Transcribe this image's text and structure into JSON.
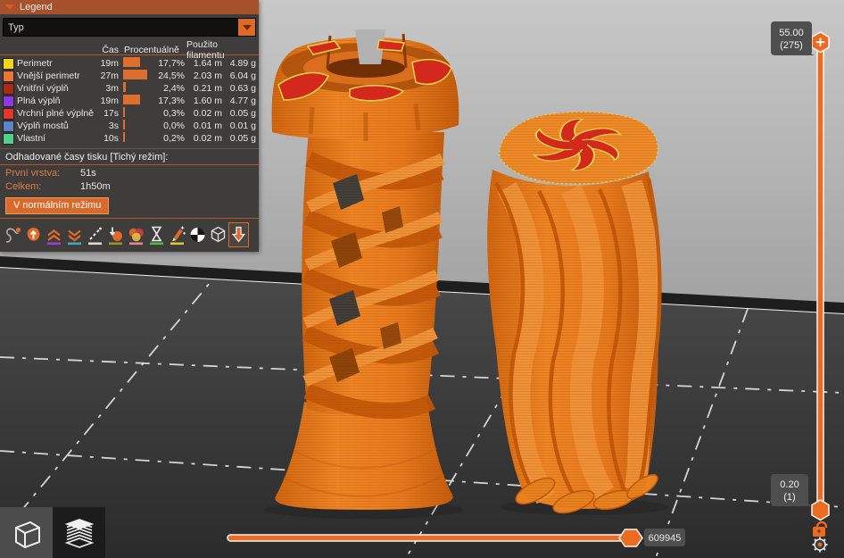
{
  "colors": {
    "accent": "#ed6b21",
    "legend_header_bg": "#a6512c",
    "panel_bg": "#3e3d3b",
    "tooltip_bg": "#4e4e4e",
    "bed_surface": "#3f3f3f",
    "model_orange": "#e87a22",
    "model_red": "#d3281c",
    "model_yellow": "#e8d44d"
  },
  "legend": {
    "title": "Legend",
    "view_type_dropdown": {
      "value": "Typ"
    },
    "table": {
      "headers": {
        "time": "Čas",
        "percent": "Procentuálně",
        "used": "Použito filamentu"
      },
      "rows": [
        {
          "color": "#f5d617",
          "label": "Perimetr",
          "time": "19m",
          "percent_value": 17.7,
          "percent": "17,7%",
          "length": "1.64 m",
          "weight": "4.89 g"
        },
        {
          "color": "#ed7435",
          "label": "Vnější perimetr",
          "time": "27m",
          "percent_value": 24.5,
          "percent": "24,5%",
          "length": "2.03 m",
          "weight": "6.04 g"
        },
        {
          "color": "#ab2a17",
          "label": "Vnitřní výplň",
          "time": "3m",
          "percent_value": 2.4,
          "percent": "2,4%",
          "length": "0.21 m",
          "weight": "0.63 g"
        },
        {
          "color": "#8f37e5",
          "label": "Plná výplň",
          "time": "19m",
          "percent_value": 17.3,
          "percent": "17,3%",
          "length": "1.60 m",
          "weight": "4.77 g"
        },
        {
          "color": "#e8352c",
          "label": "Vrchní plné výplně",
          "time": "17s",
          "percent_value": 0.3,
          "percent": "0,3%",
          "length": "0.02 m",
          "weight": "0.05 g"
        },
        {
          "color": "#5c85c7",
          "label": "Výplň mostů",
          "time": "3s",
          "percent_value": 0.0,
          "percent": "0,0%",
          "length": "0.01 m",
          "weight": "0.01 g"
        },
        {
          "color": "#50d08e",
          "label": "Vlastní",
          "time": "10s",
          "percent_value": 0.2,
          "percent": "0,2%",
          "length": "0.02 m",
          "weight": "0.05 g"
        }
      ]
    },
    "estimates": {
      "title": "Odhadované časy tisku [Tichý režim]:",
      "first_layer_label": "První vrstva:",
      "first_layer_value": "51s",
      "total_label": "Celkem:",
      "total_value": "1h50m",
      "mode_button": "V normálním režimu"
    },
    "toolbar_icons": [
      "travel",
      "wipe",
      "retractions",
      "deretractions",
      "seams",
      "tool-changes",
      "color-changes",
      "pause-prints",
      "custom-gcodes",
      "center-of-gravity",
      "shells",
      "tool-marker"
    ]
  },
  "layer_slider": {
    "top_value": "55.00",
    "top_layer": "(275)",
    "bottom_value": "0.20",
    "bottom_layer": "(1)"
  },
  "move_slider": {
    "value": "609945"
  },
  "view_buttons": [
    "3d-editor-view",
    "sliced-preview-view"
  ]
}
